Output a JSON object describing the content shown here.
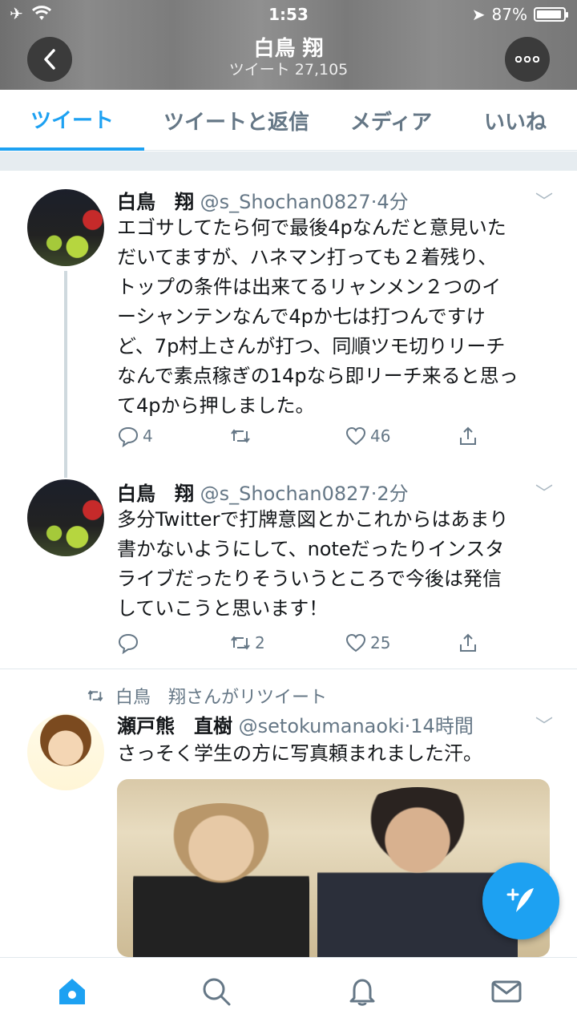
{
  "status_bar": {
    "time": "1:53",
    "battery": "87%",
    "battery_level": 0.87
  },
  "header": {
    "title": "白鳥 翔",
    "subtitle": "ツイート 27,105"
  },
  "tabs": [
    {
      "label": "ツイート",
      "active": true
    },
    {
      "label": "ツイートと返信",
      "active": false
    },
    {
      "label": "メディア",
      "active": false
    },
    {
      "label": "いいね",
      "active": false
    }
  ],
  "tweets": [
    {
      "name": "白鳥　翔",
      "handle": "@s_Shochan0827",
      "time": "4分",
      "lines": [
        "エゴサしてたら何で最後4pなんだと意見いた",
        "だいてますが、ハネマン打っても２着残り、",
        "トップの条件は出来てるリャンメン２つのイ",
        "ーシャンテンなんで4pか七は打つんですけ",
        "ど、7p村上さんが打つ、同順ツモ切りリーチ",
        "なんで素点稼ぎの14pなら即リーチ来ると思っ",
        "て4pから押しました。"
      ],
      "replies": "4",
      "retweets": "",
      "likes": "46"
    },
    {
      "name": "白鳥　翔",
      "handle": "@s_Shochan0827",
      "time": "2分",
      "lines": [
        "多分Twitterで打牌意図とかこれからはあまり",
        "書かないようにして、noteだったりインスタ",
        "ライブだったりそういうところで今後は発信",
        "していこうと思います！"
      ],
      "replies": "",
      "retweets": "2",
      "likes": "25"
    },
    {
      "retweeted_by": "白鳥　翔さんがリツイート",
      "name": "瀬戸熊　直樹",
      "handle": "@setokumanaoki",
      "time": "14時間",
      "lines": [
        "さっそく学生の方に写真頼まれました汗。"
      ]
    }
  ],
  "colors": {
    "accent": "#1da1f2",
    "text": "#14171a",
    "muted": "#657786"
  },
  "icons": [
    "back-icon",
    "more-icon",
    "reply-icon",
    "retweet-icon",
    "like-icon",
    "share-icon",
    "home-icon",
    "search-icon",
    "notifications-icon",
    "messages-icon",
    "compose-icon"
  ]
}
